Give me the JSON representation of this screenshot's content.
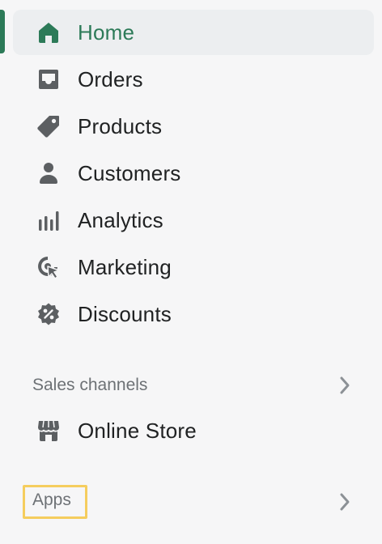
{
  "nav": {
    "items": [
      {
        "label": "Home",
        "icon": "home-icon",
        "active": true
      },
      {
        "label": "Orders",
        "icon": "orders-inbox-icon",
        "active": false
      },
      {
        "label": "Products",
        "icon": "tag-icon",
        "active": false
      },
      {
        "label": "Customers",
        "icon": "person-icon",
        "active": false
      },
      {
        "label": "Analytics",
        "icon": "bar-chart-icon",
        "active": false
      },
      {
        "label": "Marketing",
        "icon": "target-cursor-icon",
        "active": false
      },
      {
        "label": "Discounts",
        "icon": "percent-badge-icon",
        "active": false
      }
    ]
  },
  "sales_channels": {
    "title": "Sales channels",
    "items": [
      {
        "label": "Online Store",
        "icon": "storefront-icon"
      }
    ]
  },
  "apps": {
    "title": "Apps"
  },
  "colors": {
    "active": "#2c7a58",
    "icon": "#5c5f62",
    "section_title": "#6d7175",
    "highlight": "#f5cd5e",
    "background": "#f6f6f7"
  }
}
